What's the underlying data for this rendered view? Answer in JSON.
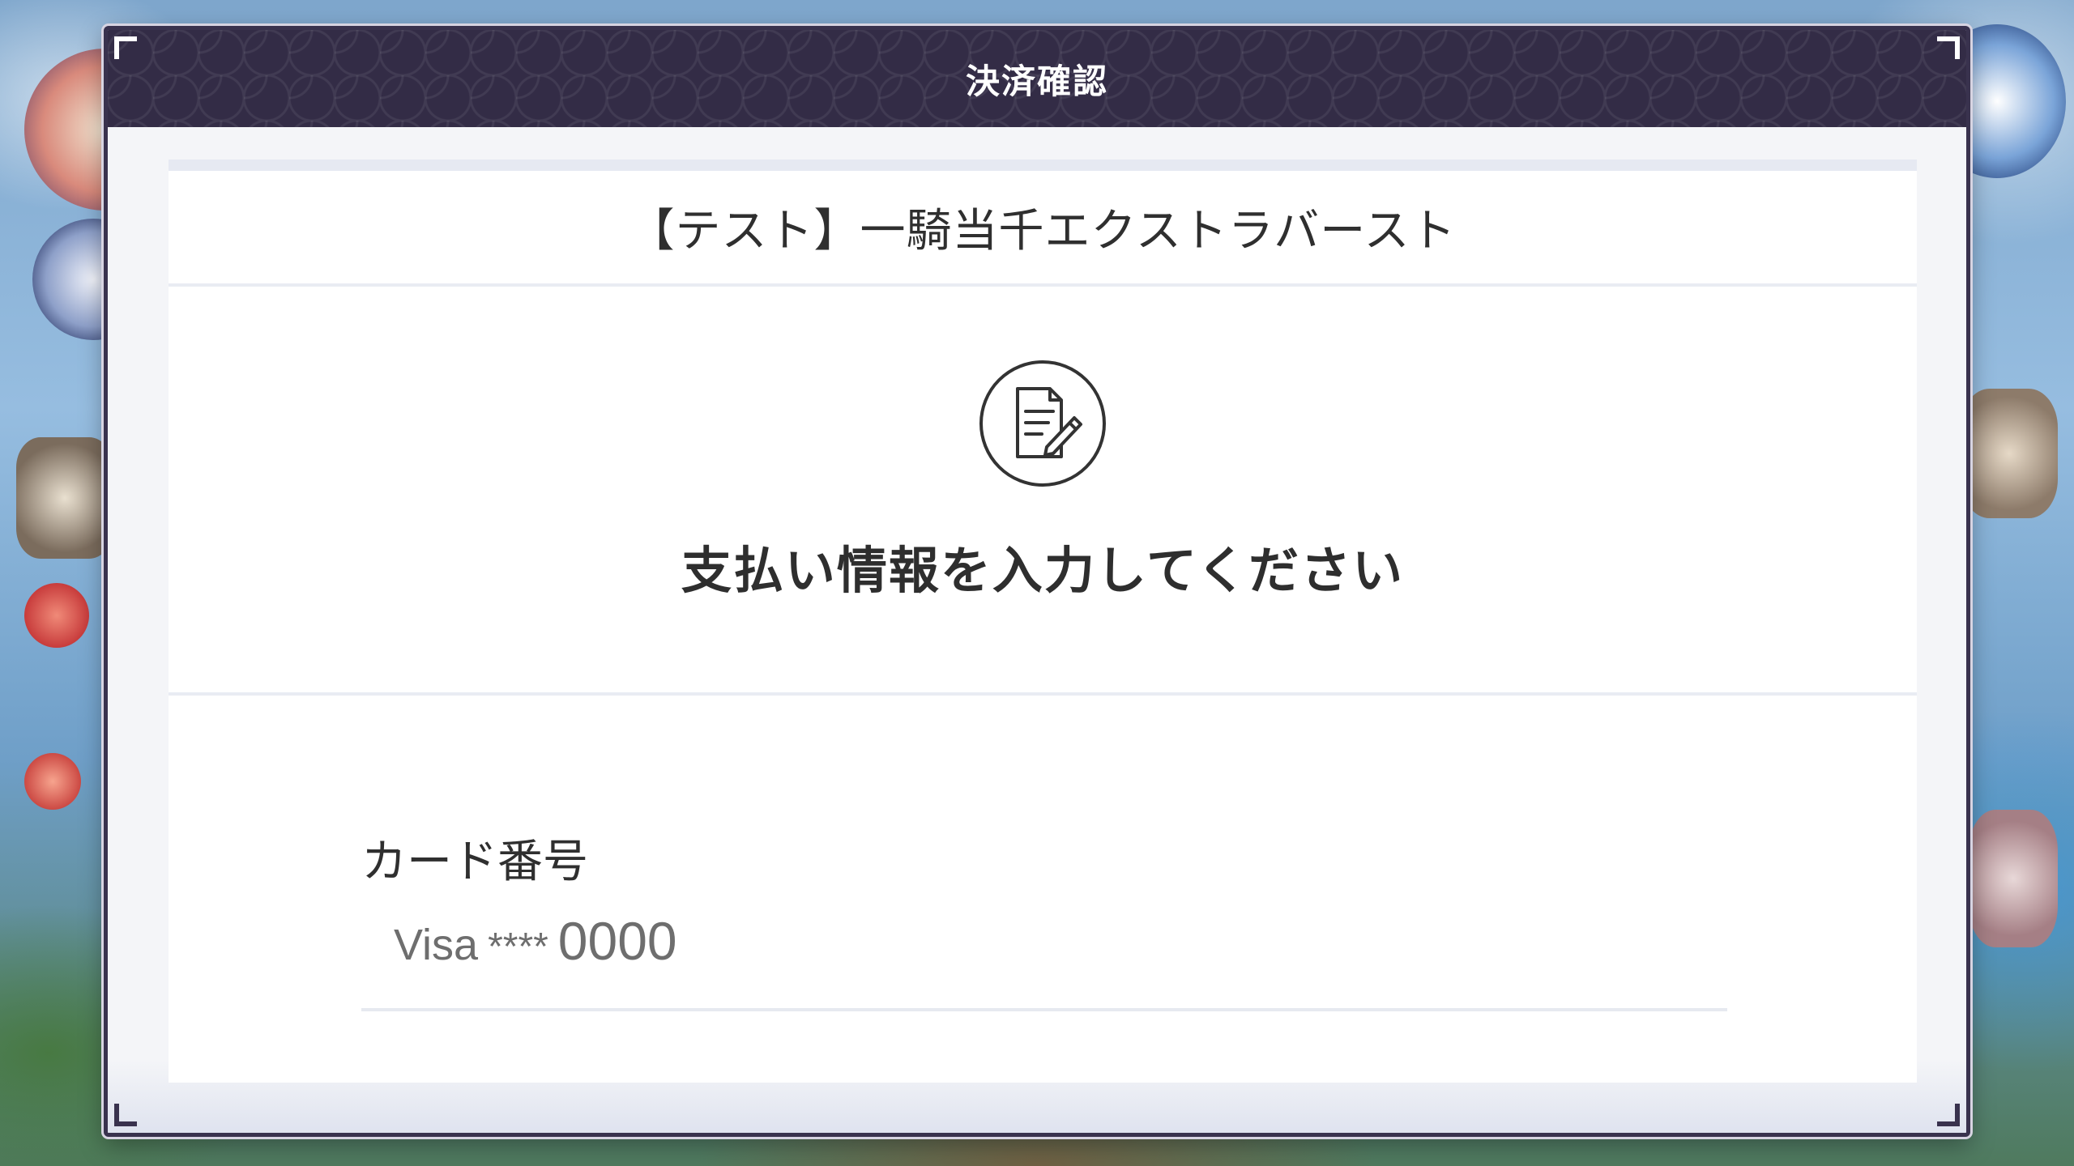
{
  "modal": {
    "title": "決済確認"
  },
  "product": {
    "name": "【テスト】一騎当千エクストラバースト"
  },
  "prompt": {
    "icon": "document-edit-icon",
    "text": "支払い情報を入力してください"
  },
  "card": {
    "label": "カード番号",
    "brand": "Visa",
    "mask": "****",
    "last4": "0000"
  },
  "colors": {
    "header_bg": "#332c46",
    "frame_border": "#39324e",
    "panel_bg": "#ffffff",
    "text_primary": "#2e2e2e",
    "text_muted": "#6e6e6e",
    "divider": "#e9ecf3"
  }
}
